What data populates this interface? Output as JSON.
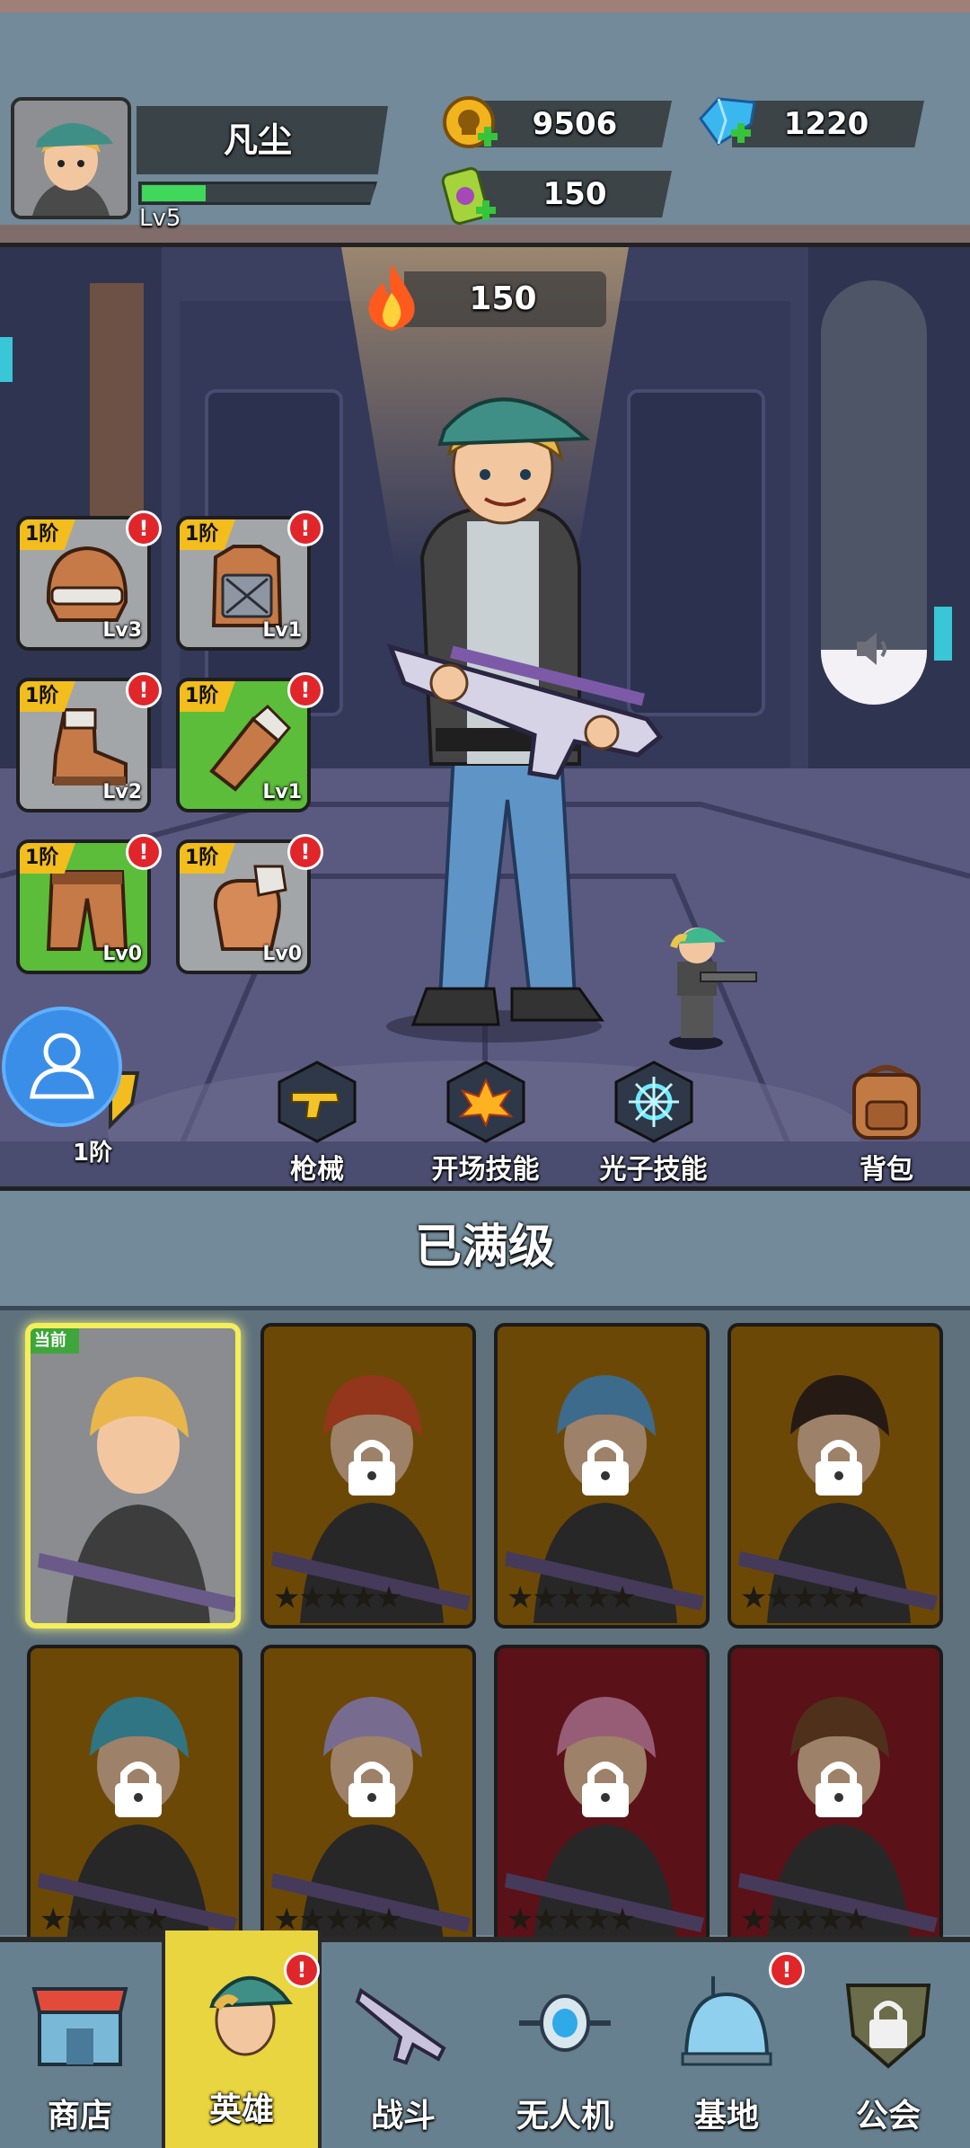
{
  "player": {
    "name": "凡尘",
    "level": "Lv5",
    "xp_progress": 0.27
  },
  "resources": {
    "gold": "9506",
    "diamonds": "1220",
    "energy": "150"
  },
  "hero_view": {
    "combat_power": "150",
    "volume_level": 0.13,
    "equipment": [
      {
        "tier": "1阶",
        "level": "Lv3",
        "icon": "helmet-icon",
        "bg": "gray"
      },
      {
        "tier": "1阶",
        "level": "Lv1",
        "icon": "armor-vest-icon",
        "bg": "gray"
      },
      {
        "tier": "1阶",
        "level": "Lv2",
        "icon": "boots-icon",
        "bg": "gray"
      },
      {
        "tier": "1阶",
        "level": "Lv1",
        "icon": "arm-guard-icon",
        "bg": "green"
      },
      {
        "tier": "1阶",
        "level": "Lv0",
        "icon": "pants-icon",
        "bg": "green"
      },
      {
        "tier": "1阶",
        "level": "Lv0",
        "icon": "gloves-icon",
        "bg": "gray"
      }
    ],
    "alert_mark": "!",
    "actions": {
      "rank": "1阶",
      "firearms": "枪械",
      "opening_skill": "开场技能",
      "photon_skill": "光子技能",
      "backpack": "背包"
    }
  },
  "status": "已满级",
  "hero_cards": {
    "current_badge": "当前",
    "star_text": "★★★★★",
    "cards": [
      {
        "state": "current",
        "color": "gray",
        "hair": "#e8b64a"
      },
      {
        "state": "locked",
        "color": "gold",
        "hair": "#e2542a"
      },
      {
        "state": "locked",
        "color": "gold",
        "hair": "#5ea5d8"
      },
      {
        "state": "locked",
        "color": "gold",
        "hair": "#3b2a20"
      },
      {
        "state": "locked",
        "color": "gold",
        "hair": "#4ab4c9"
      },
      {
        "state": "locked",
        "color": "gold",
        "hair": "#b7a7de"
      },
      {
        "state": "locked",
        "color": "red",
        "hair": "#e88fb5"
      },
      {
        "state": "locked",
        "color": "red",
        "hair": "#7a4a2a"
      }
    ]
  },
  "nav": {
    "shop": "商店",
    "hero": "英雄",
    "battle": "战斗",
    "drone": "无人机",
    "base": "基地",
    "guild": "公会"
  },
  "colors": {
    "accent_gold": "#f2bd1d",
    "xp_green": "#3fd85a",
    "alert_red": "#e0262b",
    "active_tab": "#e8d53f"
  }
}
